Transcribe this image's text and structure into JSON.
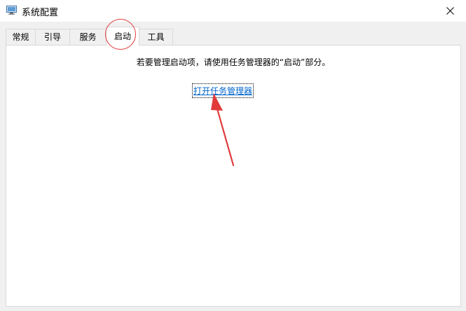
{
  "window": {
    "title": "系统配置",
    "icon": "msconfig-app-icon",
    "close_glyph": "✕"
  },
  "tabs": [
    {
      "label": "常规",
      "active": false
    },
    {
      "label": "引导",
      "active": false
    },
    {
      "label": "服务",
      "active": false
    },
    {
      "label": "启动",
      "active": true
    },
    {
      "label": "工具",
      "active": false
    }
  ],
  "startup": {
    "message": "若要管理启动项，请使用任务管理器的“启动”部分。",
    "link_text": "打开任务管理器"
  },
  "annotation": {
    "color": "#e03a3a",
    "circle_target": "tab-startup",
    "arrow_target": "open-task-manager-link"
  }
}
